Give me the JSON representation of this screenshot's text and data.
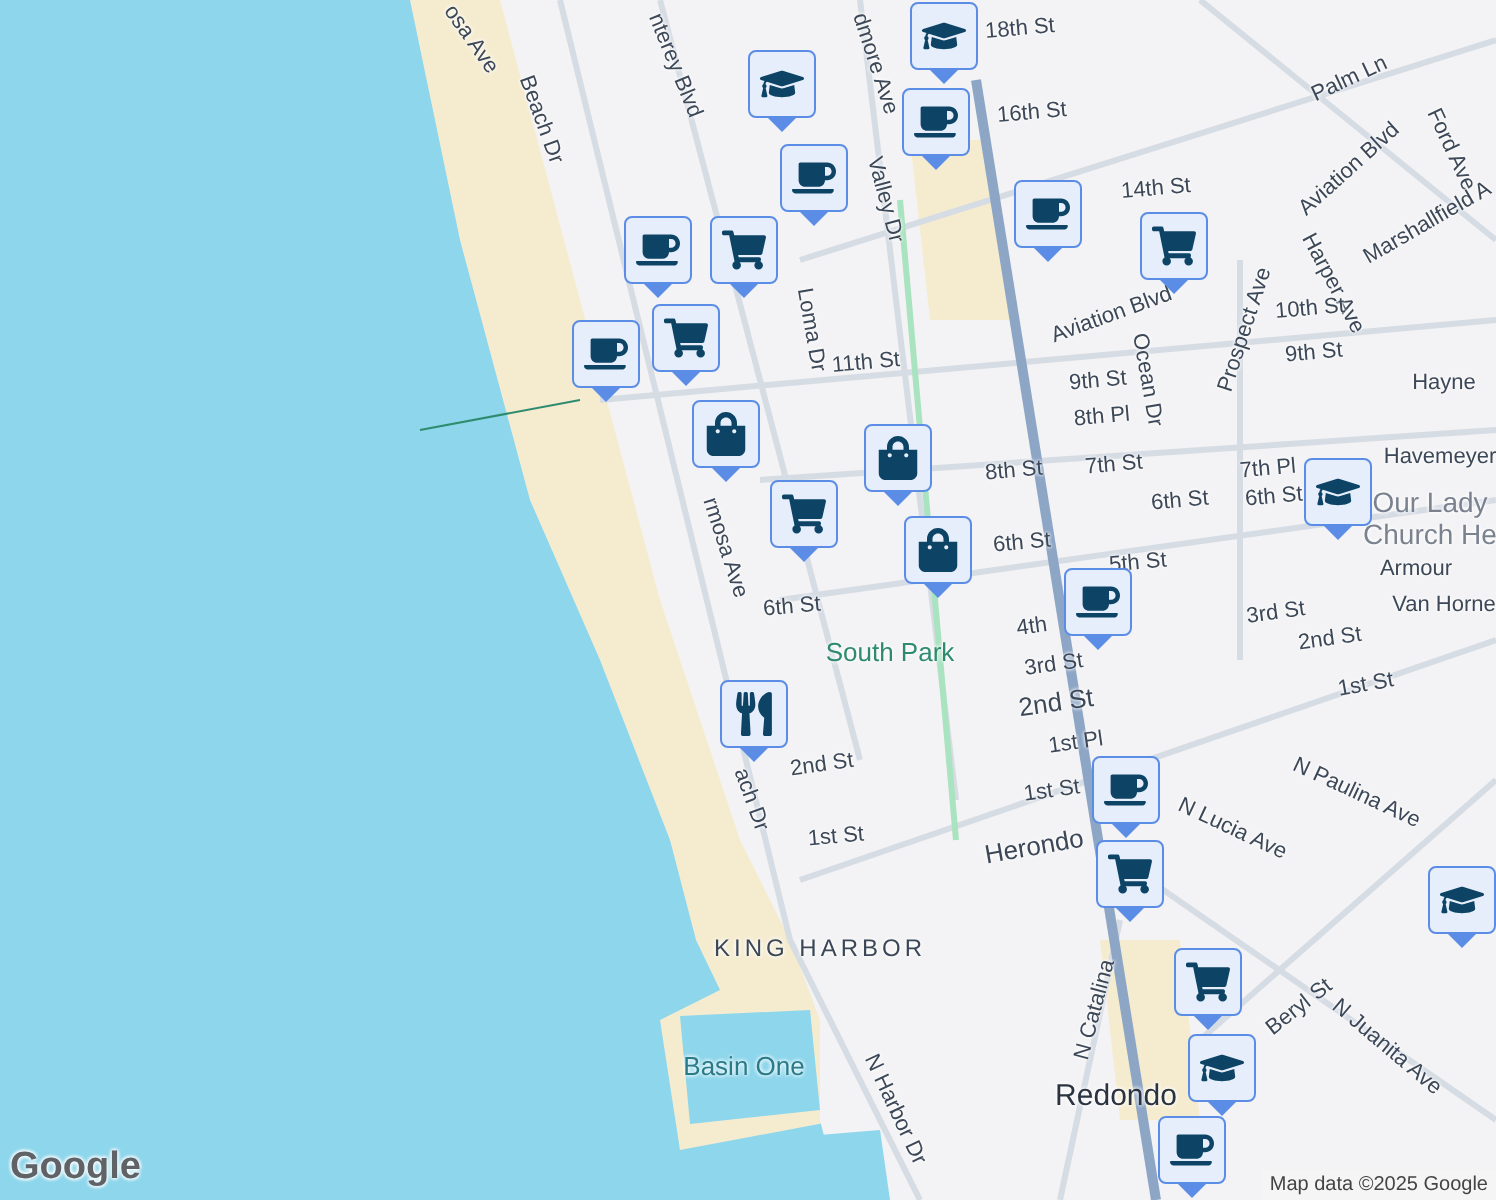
{
  "map": {
    "labels": [
      {
        "text": "osa Ave",
        "kind": "street"
      },
      {
        "text": "Beach Dr",
        "kind": "street"
      },
      {
        "text": "nterey Blvd",
        "kind": "street"
      },
      {
        "text": "18th St",
        "kind": "street"
      },
      {
        "text": "dmore Ave",
        "kind": "street"
      },
      {
        "text": "Valley Dr",
        "kind": "street"
      },
      {
        "text": "16th St",
        "kind": "street"
      },
      {
        "text": "14th St",
        "kind": "street"
      },
      {
        "text": "Palm Ln",
        "kind": "street"
      },
      {
        "text": "Aviation Blvd",
        "kind": "street"
      },
      {
        "text": "Ford Ave",
        "kind": "street"
      },
      {
        "text": "Marshallfield A",
        "kind": "street"
      },
      {
        "text": "Harper Ave",
        "kind": "street"
      },
      {
        "text": "Loma Dr",
        "kind": "street"
      },
      {
        "text": "11th St",
        "kind": "street"
      },
      {
        "text": "Aviation Blvd",
        "kind": "street"
      },
      {
        "text": "10th St",
        "kind": "street"
      },
      {
        "text": "Prospect Ave",
        "kind": "street"
      },
      {
        "text": "9th St",
        "kind": "street"
      },
      {
        "text": "9th St",
        "kind": "street"
      },
      {
        "text": "Ocean Dr",
        "kind": "street"
      },
      {
        "text": "8th Pl",
        "kind": "street"
      },
      {
        "text": "Hayne",
        "kind": "street"
      },
      {
        "text": "Havemeyer",
        "kind": "street"
      },
      {
        "text": "7th Pl",
        "kind": "street"
      },
      {
        "text": "8th St",
        "kind": "street"
      },
      {
        "text": "7th St",
        "kind": "street"
      },
      {
        "text": "6th St",
        "kind": "street"
      },
      {
        "text": "6th St",
        "kind": "street"
      },
      {
        "text": "Our Lady",
        "kind": "place"
      },
      {
        "text": "Church He",
        "kind": "place"
      },
      {
        "text": "6th St",
        "kind": "street"
      },
      {
        "text": "5th St",
        "kind": "street"
      },
      {
        "text": "Armour",
        "kind": "street"
      },
      {
        "text": "rmosa Ave",
        "kind": "street"
      },
      {
        "text": "6th St",
        "kind": "street"
      },
      {
        "text": "Van Horne",
        "kind": "street"
      },
      {
        "text": "3rd St",
        "kind": "street"
      },
      {
        "text": "4th",
        "kind": "street"
      },
      {
        "text": "South Park",
        "kind": "park"
      },
      {
        "text": "2nd St",
        "kind": "street"
      },
      {
        "text": "3rd St",
        "kind": "street"
      },
      {
        "text": "1st St",
        "kind": "street"
      },
      {
        "text": "2nd St",
        "kind": "major"
      },
      {
        "text": "1st Pl",
        "kind": "street"
      },
      {
        "text": "2nd St",
        "kind": "street"
      },
      {
        "text": "ach Dr",
        "kind": "street"
      },
      {
        "text": "1st St",
        "kind": "street"
      },
      {
        "text": "1st St",
        "kind": "street"
      },
      {
        "text": "Herondo",
        "kind": "major"
      },
      {
        "text": "N Paulina Ave",
        "kind": "street"
      },
      {
        "text": "N Lucia Ave",
        "kind": "street"
      },
      {
        "text": "KING HARBOR",
        "kind": "area"
      },
      {
        "text": "N Catalina",
        "kind": "street"
      },
      {
        "text": "Beryl St",
        "kind": "street"
      },
      {
        "text": "N Juanita Ave",
        "kind": "street"
      },
      {
        "text": "Basin One",
        "kind": "water"
      },
      {
        "text": "N Harbor Dr",
        "kind": "street"
      },
      {
        "text": "Redondo",
        "kind": "city"
      }
    ],
    "pins": [
      {
        "kind": "school"
      },
      {
        "kind": "school"
      },
      {
        "kind": "coffee"
      },
      {
        "kind": "coffee"
      },
      {
        "kind": "coffee"
      },
      {
        "kind": "cart"
      },
      {
        "kind": "coffee"
      },
      {
        "kind": "cart"
      },
      {
        "kind": "coffee"
      },
      {
        "kind": "cart"
      },
      {
        "kind": "bag"
      },
      {
        "kind": "cart"
      },
      {
        "kind": "bag"
      },
      {
        "kind": "bag"
      },
      {
        "kind": "coffee"
      },
      {
        "kind": "school"
      },
      {
        "kind": "food"
      },
      {
        "kind": "coffee"
      },
      {
        "kind": "cart"
      },
      {
        "kind": "school"
      },
      {
        "kind": "cart"
      },
      {
        "kind": "school"
      },
      {
        "kind": "coffee"
      }
    ]
  },
  "logo": "Google",
  "attribution": "Map data ©2025 Google"
}
